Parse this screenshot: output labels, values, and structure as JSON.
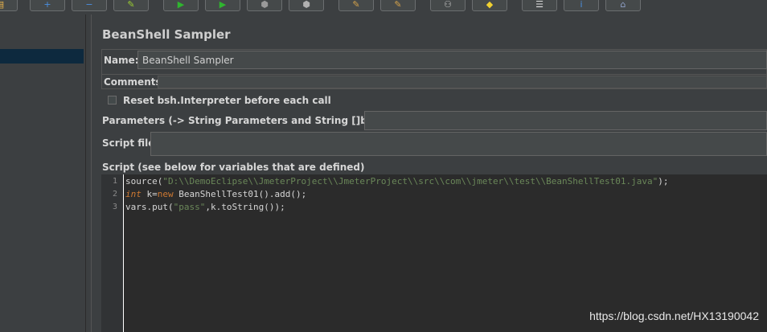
{
  "toolbar": {
    "buttons": [
      {
        "name": "open-icon",
        "glyph": "▤",
        "color": "#e8b24a"
      },
      {
        "name": "add-icon",
        "glyph": "+",
        "color": "#4a8fe0"
      },
      {
        "name": "remove-icon",
        "glyph": "−",
        "color": "#4a8fe0"
      },
      {
        "name": "toggle-icon",
        "glyph": "✎",
        "color": "#9acd32"
      },
      {
        "name": "start-icon",
        "glyph": "▶",
        "color": "#2fb52f"
      },
      {
        "name": "start-no-pauses-icon",
        "glyph": "▶",
        "color": "#2fb52f"
      },
      {
        "name": "stop-icon",
        "glyph": "⬢",
        "color": "#9a9a9a"
      },
      {
        "name": "shutdown-icon",
        "glyph": "⬢",
        "color": "#b0b0b0"
      },
      {
        "name": "clear-icon",
        "glyph": "✎",
        "color": "#d4a24a"
      },
      {
        "name": "clear-all-icon",
        "glyph": "✎",
        "color": "#d4a24a"
      },
      {
        "name": "search-icon",
        "glyph": "⚇",
        "color": "#c0c0c0"
      },
      {
        "name": "reset-search-icon",
        "glyph": "◆",
        "color": "#f0d030"
      },
      {
        "name": "function-helper-icon",
        "glyph": "☰",
        "color": "#e0e0e0"
      },
      {
        "name": "help-icon",
        "glyph": "i",
        "color": "#4a8fe0"
      },
      {
        "name": "remote-icon",
        "glyph": "⌂",
        "color": "#8fa0c8"
      }
    ]
  },
  "panel": {
    "title": "BeanShell Sampler",
    "name_label": "Name:",
    "name_value": "BeanShell Sampler",
    "comments_label": "Comments:",
    "reset_label": "Reset bsh.Interpreter before each call",
    "parameters_label": "Parameters (-> String Parameters and String []bsh.args)",
    "script_file_label": "Script file",
    "script_label": "Script (see below for variables that are defined)"
  },
  "script": {
    "line_numbers": [
      "1",
      "2",
      "3"
    ],
    "line1": {
      "a": "source(",
      "b": "\"D:\\\\DemoEclipse\\\\JmeterProject\\\\JmeterProject\\\\src\\\\com\\\\jmeter\\\\test\\\\BeanShellTest01.java\"",
      "c": ");"
    },
    "line2": {
      "a": "int",
      "b": " k=",
      "c": "new",
      "d": " BeanShellTest01().add();"
    },
    "line3": {
      "a": "vars.put(",
      "b": "\"pass\"",
      "c": ",k.toString());"
    }
  },
  "watermark": "https://blog.csdn.net/HX13190042"
}
